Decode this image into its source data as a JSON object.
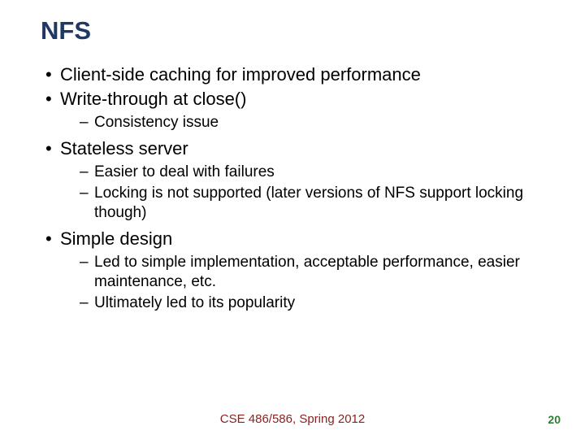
{
  "title": "NFS",
  "bullets": [
    {
      "text": "Client-side caching for improved performance",
      "sub": []
    },
    {
      "text": "Write-through at close()",
      "sub": [
        "Consistency issue"
      ]
    },
    {
      "text": "Stateless server",
      "sub": [
        "Easier to deal with failures",
        "Locking is not supported (later versions of NFS support locking though)"
      ]
    },
    {
      "text": "Simple design",
      "sub": [
        "Led to simple implementation, acceptable performance, easier maintenance, etc.",
        "Ultimately led to its popularity"
      ]
    }
  ],
  "footer": "CSE 486/586, Spring 2012",
  "page_number": "20"
}
